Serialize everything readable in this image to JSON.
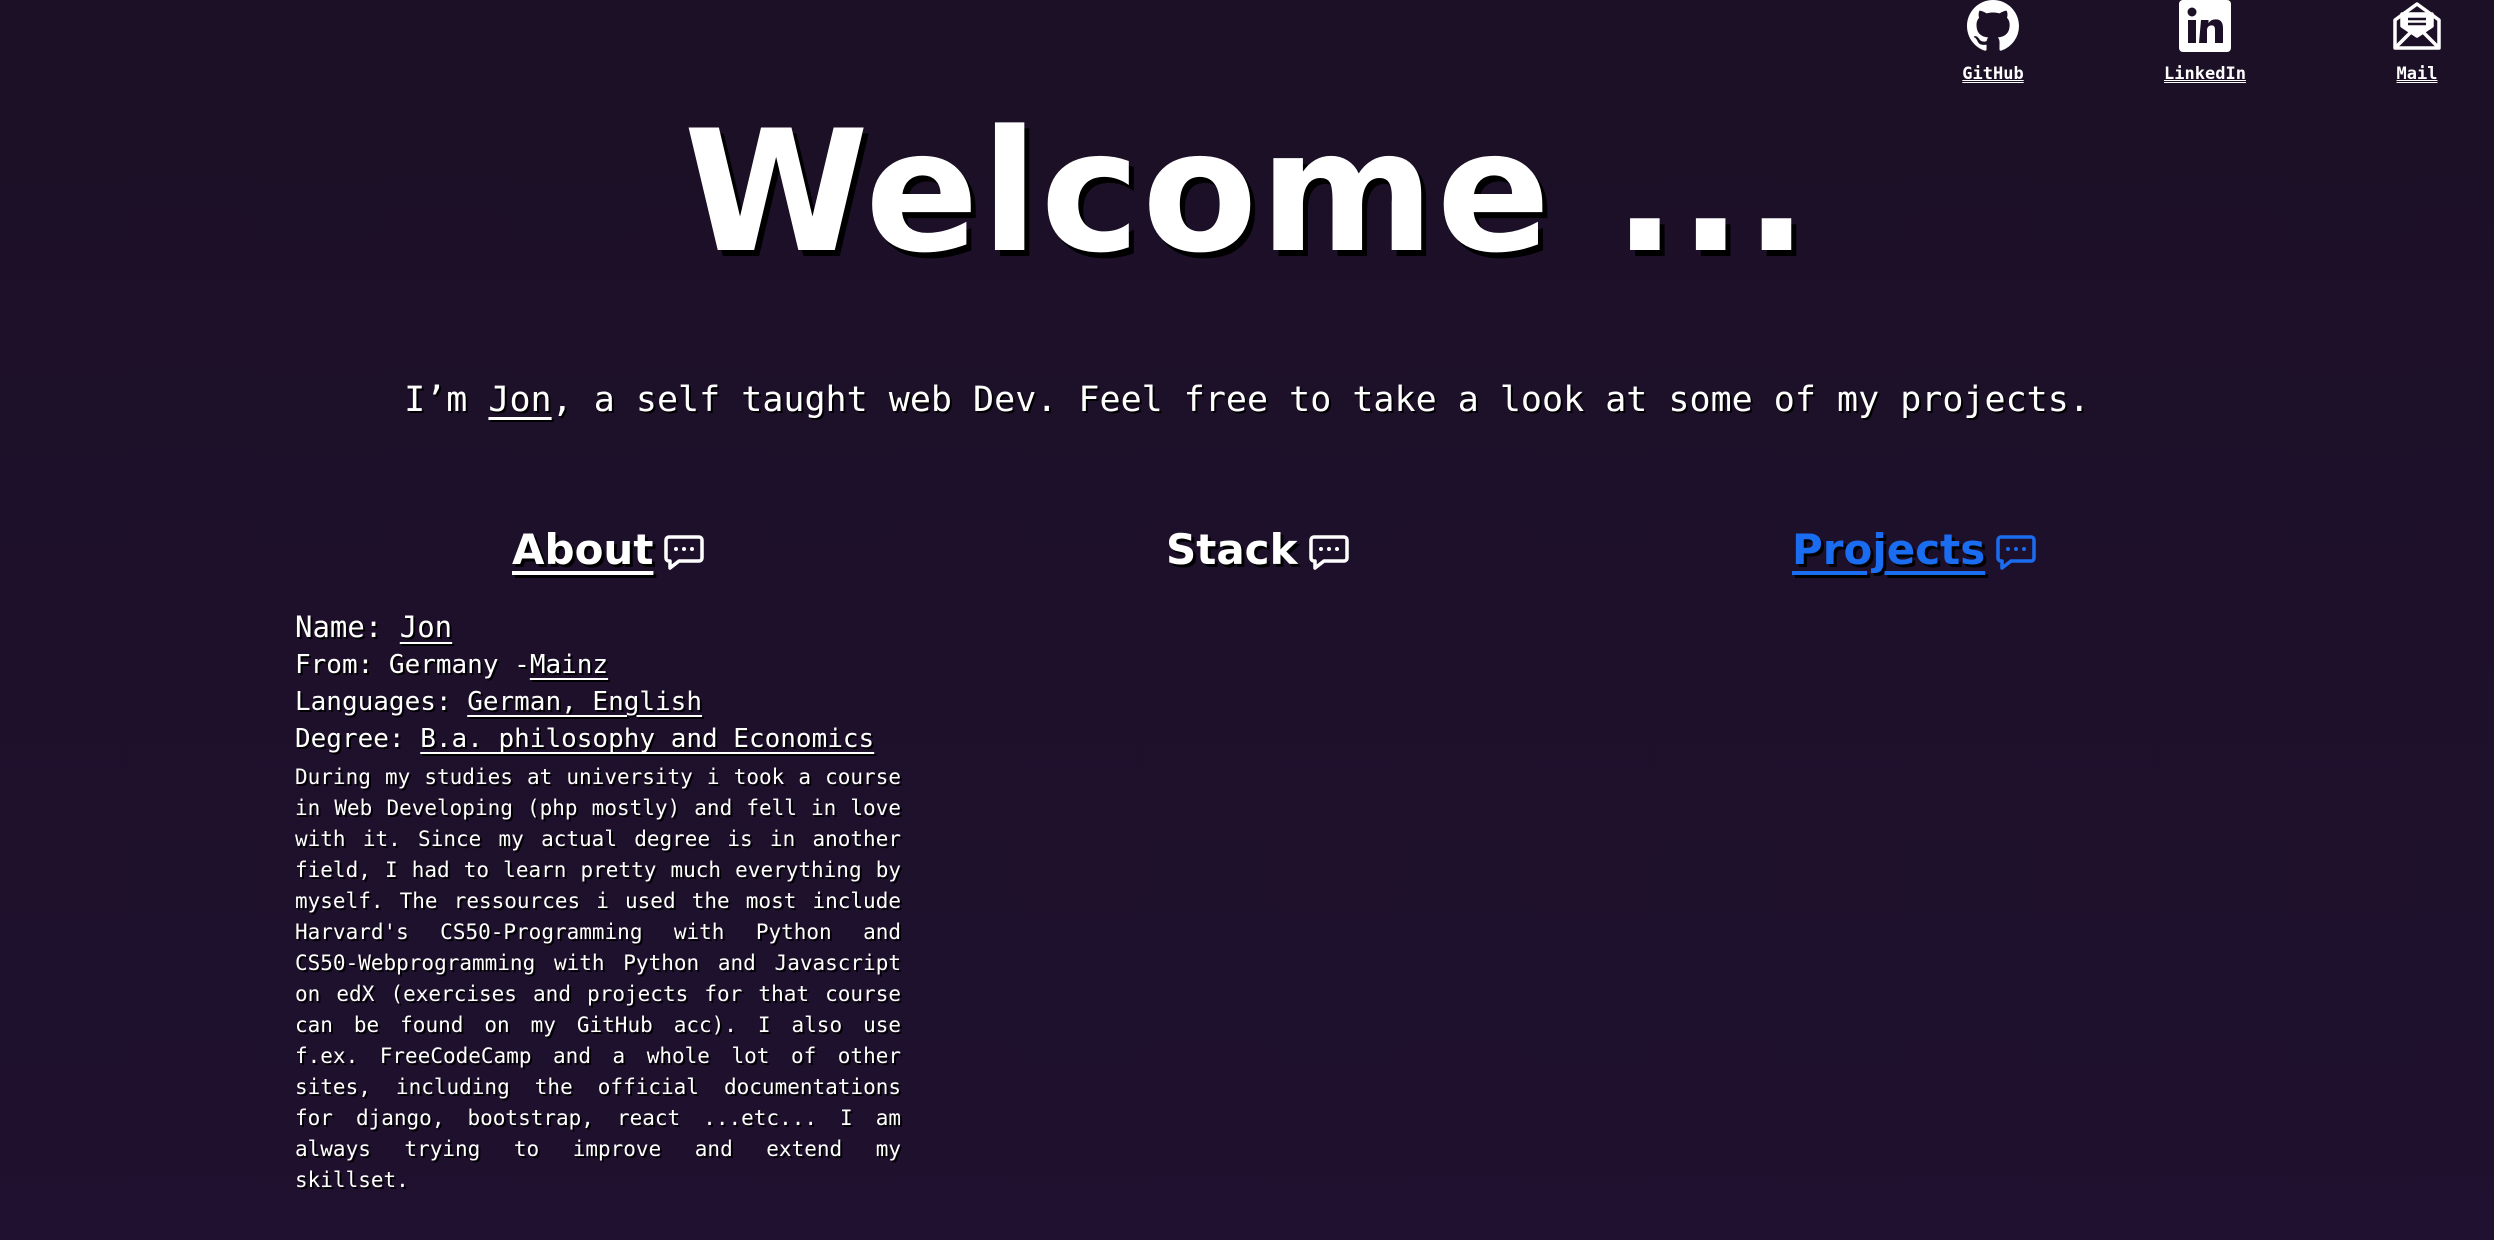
{
  "social": {
    "github": {
      "label": "GitHub",
      "icon": "github-icon"
    },
    "linkedin": {
      "label": "LinkedIn",
      "icon": "linkedin-icon"
    },
    "mail": {
      "label": "Mail",
      "icon": "mail-icon"
    }
  },
  "hero": {
    "title": "Welcome ...",
    "intro_before": "I’m ",
    "intro_name": "Jon",
    "intro_after": ", a self taught web Dev. Feel free to take a look at some of my projects."
  },
  "tabs": {
    "about": {
      "label": "About",
      "icon": "chat-bubble-icon"
    },
    "stack": {
      "label": "Stack",
      "icon": "chat-bubble-icon"
    },
    "projects": {
      "label": "Projects",
      "icon": "chat-bubble-icon",
      "color": "#1a6cf0"
    }
  },
  "about": {
    "name_label": "Name: ",
    "name_value": "Jon",
    "from_label": "From: Germany -",
    "from_value": "Mainz",
    "languages_label": "Languages: ",
    "languages_value": "German, English",
    "degree_label": "Degree: ",
    "degree_value": "B.a. philosophy and Economics",
    "bio": "During my studies at university i took a course in Web Developing (php mostly) and fell in love with it. Since my actual degree is in another field, I had to learn pretty much everything by myself. The ressources i used the most include Harvard's CS50-Programming with Python and CS50-Webprogramming with Python and Javascript on edX (exercises and projects for that course can be found on my GitHub acc). I also use f.ex. FreeCodeCamp and a whole lot of other sites, including the official documentations for django, bootstrap, react ...etc... I am always trying to improve and extend my skillset."
  },
  "colors": {
    "background": "#1c1026",
    "text": "#ffffff",
    "accent": "#1a6cf0"
  }
}
